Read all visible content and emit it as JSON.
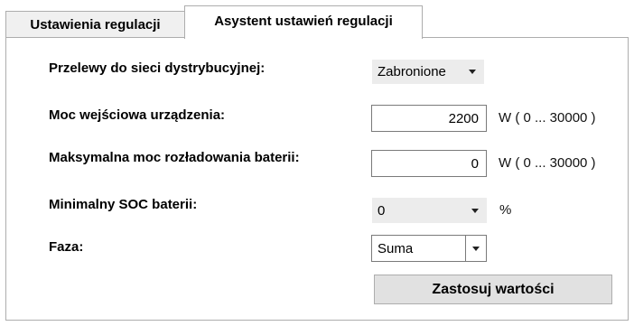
{
  "tabs": [
    {
      "label": "Ustawienia regulacji",
      "active": false
    },
    {
      "label": "Asystent ustawień regulacji",
      "active": true
    }
  ],
  "form": {
    "grid_export": {
      "label": "Przelewy do sieci dystrybucyjnej:",
      "value": "Zabronione"
    },
    "input_power": {
      "label": "Moc wejściowa urządzenia:",
      "value": "2200",
      "unit": "W ( 0 ... 30000 )"
    },
    "max_discharge": {
      "label": "Maksymalna moc rozładowania baterii:",
      "value": "0",
      "unit": "W ( 0 ... 30000 )"
    },
    "min_soc": {
      "label": "Minimalny SOC baterii:",
      "value": "0",
      "unit": "%"
    },
    "phase": {
      "label": "Faza:",
      "value": "Suma"
    },
    "apply_label": "Zastosuj wartości"
  },
  "icons": {
    "dropdown": "chevron-down-icon"
  }
}
